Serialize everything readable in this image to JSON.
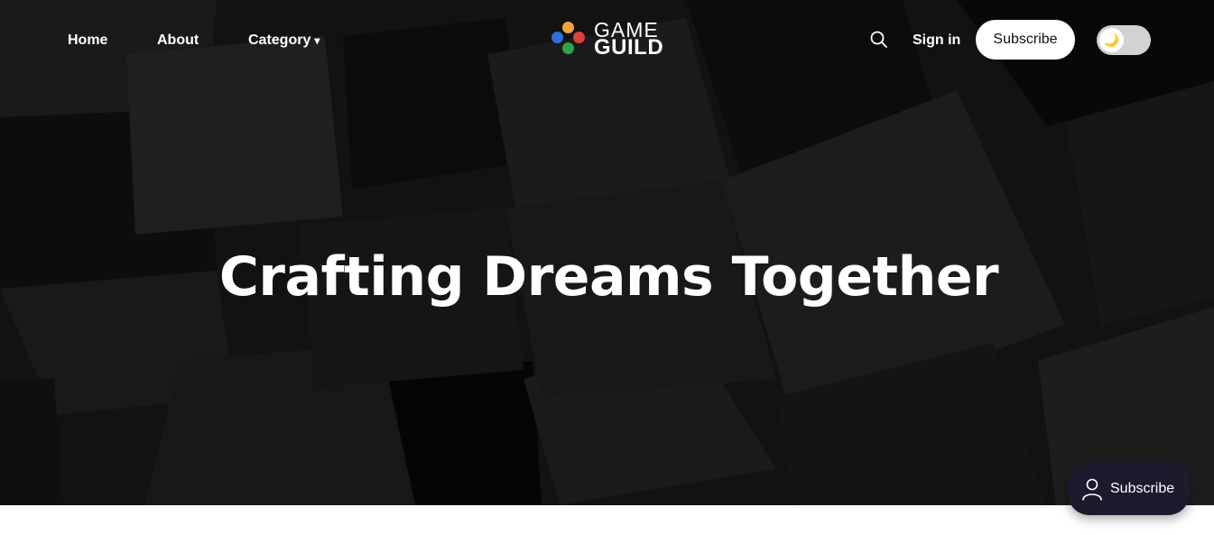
{
  "nav": {
    "home": "Home",
    "about": "About",
    "category": "Category",
    "category_caret": "▾",
    "sign_in": "Sign in",
    "subscribe": "Subscribe",
    "toggle_icon": "🌙"
  },
  "logo": {
    "line1": "GAME",
    "line2": "GUILD",
    "dot_colors": [
      "#f3a33a",
      "#2f6fd8",
      "#e0403a",
      "#31a34a"
    ]
  },
  "hero": {
    "title": "Crafting Dreams Together"
  },
  "floating": {
    "subscribe": "Subscribe"
  },
  "icons": {
    "search": "search-icon",
    "user": "user-icon",
    "moon": "moon-icon"
  },
  "colors": {
    "hero_bg": "#111111",
    "floating_button_bg": "#1c1b2d",
    "toggle_bg": "#d2d2d2"
  }
}
